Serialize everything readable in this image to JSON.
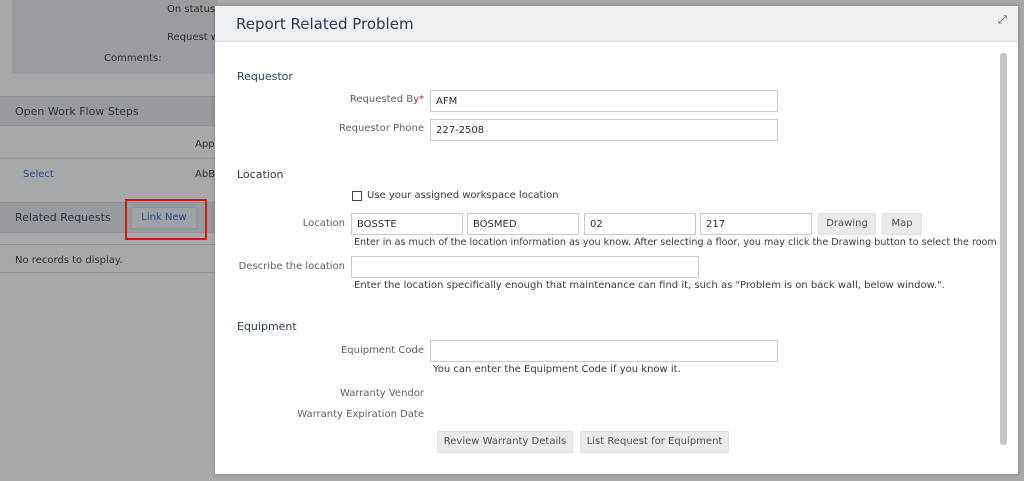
{
  "background": {
    "on_status_label": "On status",
    "request_label_partial": "Request w",
    "comments_label": "Comments:",
    "open_workflow_title": "Open Work Flow Steps",
    "app_partial": "App",
    "select_link": "Select",
    "abb_partial": "AbB",
    "related_requests_title": "Related Requests",
    "link_new_label": "Link New",
    "no_records": "No records to display."
  },
  "modal": {
    "title": "Report Related Problem",
    "requestor": {
      "section_title": "Requestor",
      "requested_by_label": "Requested By",
      "requested_by_required": "*",
      "requested_by_value": "AFM",
      "phone_label": "Requestor Phone",
      "phone_value": "227-2508"
    },
    "location": {
      "section_title": "Location",
      "use_workspace_label": "Use your assigned workspace location",
      "location_label": "Location",
      "building_value": "BOSSTE",
      "site_value": "BOSMED",
      "floor_value": "02",
      "room_value": "217",
      "drawing_button": "Drawing",
      "map_button": "Map",
      "location_hint": "Enter in as much of the location information as you know. After selecting a floor, you may click the Drawing button to select the room",
      "describe_label": "Describe the location",
      "describe_value": "",
      "describe_hint": "Enter the location specifically enough that maintenance can find it, such as \"Problem is on back wall, below window.\"."
    },
    "equipment": {
      "section_title": "Equipment",
      "equipment_code_label": "Equipment Code",
      "equipment_code_value": "",
      "equipment_hint": "You can enter the Equipment Code if you know it.",
      "warranty_vendor_label": "Warranty Vendor",
      "warranty_expiration_label": "Warranty Expiration Date",
      "review_warranty_button": "Review Warranty Details",
      "list_request_button": "List Request for Equipment"
    }
  },
  "colors": {
    "highlight": "#d41414",
    "required": "#c62828",
    "link": "#264d8c"
  }
}
